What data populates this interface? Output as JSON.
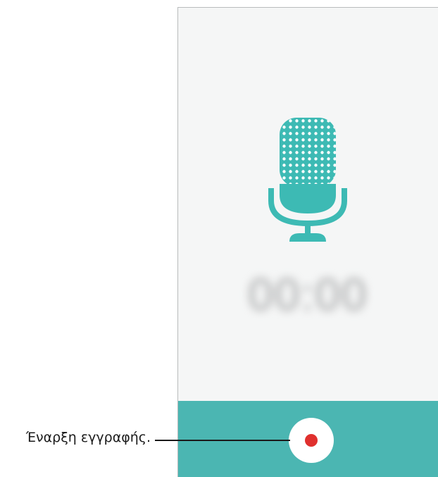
{
  "recorder": {
    "timer": "00:00",
    "record_button": "Record",
    "accent_color": "#4bb6b2",
    "record_color": "#e0302e",
    "icons": [
      "microphone-icon",
      "record-dot-icon"
    ]
  },
  "callout": {
    "label": "Έναρξη εγγραφής."
  }
}
